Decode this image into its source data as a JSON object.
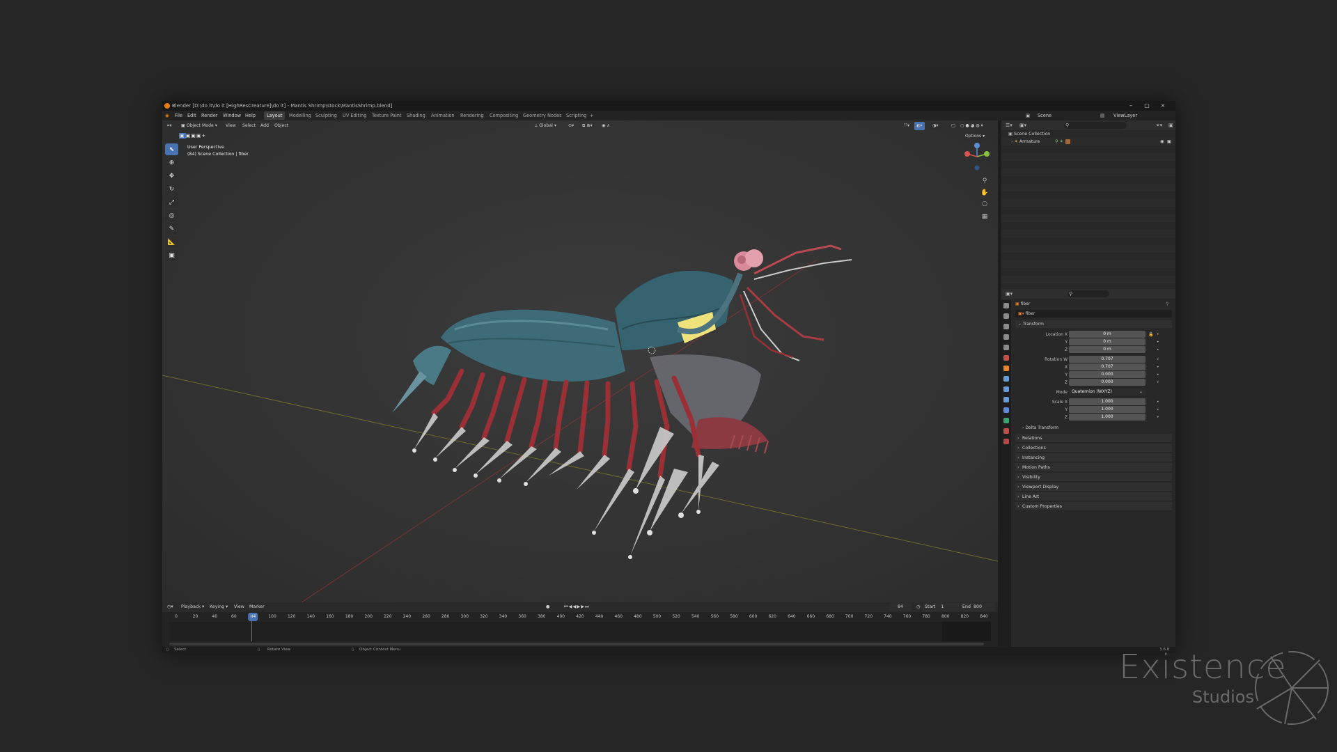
{
  "window": {
    "title": "Blender [D:\\do it\\do it [HighResCreature]\\do it] - Mantis Shrimp\\stock\\MantisShrimp.blend]",
    "controls": [
      "–",
      "□",
      "×"
    ]
  },
  "menu": {
    "items": [
      "File",
      "Edit",
      "Render",
      "Window",
      "Help"
    ],
    "workspaces": [
      "Layout",
      "Modelling",
      "Sculpting",
      "UV Editing",
      "Texture Paint",
      "Shading",
      "Animation",
      "Rendering",
      "Compositing",
      "Geometry Nodes",
      "Scripting",
      "+"
    ],
    "active_workspace": "Layout",
    "scene": "Scene",
    "view_layer": "ViewLayer"
  },
  "viewport": {
    "mode": "Object Mode",
    "menus": [
      "View",
      "Select",
      "Add",
      "Object"
    ],
    "orientation": "Global",
    "options_label": "Options",
    "info_line1": "User Perspective",
    "info_line2": "(84) Scene Collection | fiber",
    "tools": [
      "select-box",
      "cursor",
      "move",
      "rotate",
      "scale",
      "transform",
      "annotate",
      "measure",
      "add-cube"
    ]
  },
  "timeline": {
    "menus": [
      "Playback",
      "Keying",
      "View",
      "Marker"
    ],
    "current_frame": "84",
    "start_label": "Start",
    "start_value": "1",
    "end_label": "End",
    "end_value": "800",
    "ticks": [
      "0",
      "20",
      "40",
      "60",
      "84",
      "100",
      "120",
      "140",
      "160",
      "180",
      "200",
      "220",
      "240",
      "260",
      "280",
      "300",
      "320",
      "340",
      "360",
      "380",
      "400",
      "420",
      "440",
      "460",
      "480",
      "500",
      "520",
      "540",
      "560",
      "580",
      "600",
      "620",
      "640",
      "660",
      "680",
      "700",
      "720",
      "740",
      "760",
      "780",
      "800",
      "820",
      "840"
    ]
  },
  "status": {
    "items": [
      "Select",
      "Rotate View",
      "Object Context Menu"
    ],
    "version": "3.6.8"
  },
  "outliner": {
    "root": "Scene Collection",
    "items": [
      "Armature"
    ]
  },
  "properties": {
    "object_name": "fiber",
    "object_field": "fiber",
    "transform_title": "Transform",
    "location_label": "Location X",
    "y_label": "Y",
    "z_label": "Z",
    "x_label": "X",
    "w_label": "Rotation W",
    "mode_label": "Mode",
    "scale_label": "Scale X",
    "location": [
      "0 m",
      "0 m",
      "0 m"
    ],
    "rotation": [
      "0.707",
      "0.707",
      "0.000",
      "0.000"
    ],
    "mode": "Quaternion (WXYZ)",
    "scale": [
      "1.000",
      "1.000",
      "1.000"
    ],
    "delta": "Delta Transform",
    "panels": [
      "Relations",
      "Collections",
      "Instancing",
      "Motion Paths",
      "Visibility",
      "Viewport Display",
      "Line Art",
      "Custom Properties"
    ]
  },
  "watermark": {
    "line1": "Existence",
    "line2": "Studios"
  },
  "colors": {
    "accent": "#4772b3",
    "body": "#3a6b78",
    "legs": "#9a2f35",
    "bones": "#c9c9c9",
    "eyes": "#d98a9a"
  }
}
